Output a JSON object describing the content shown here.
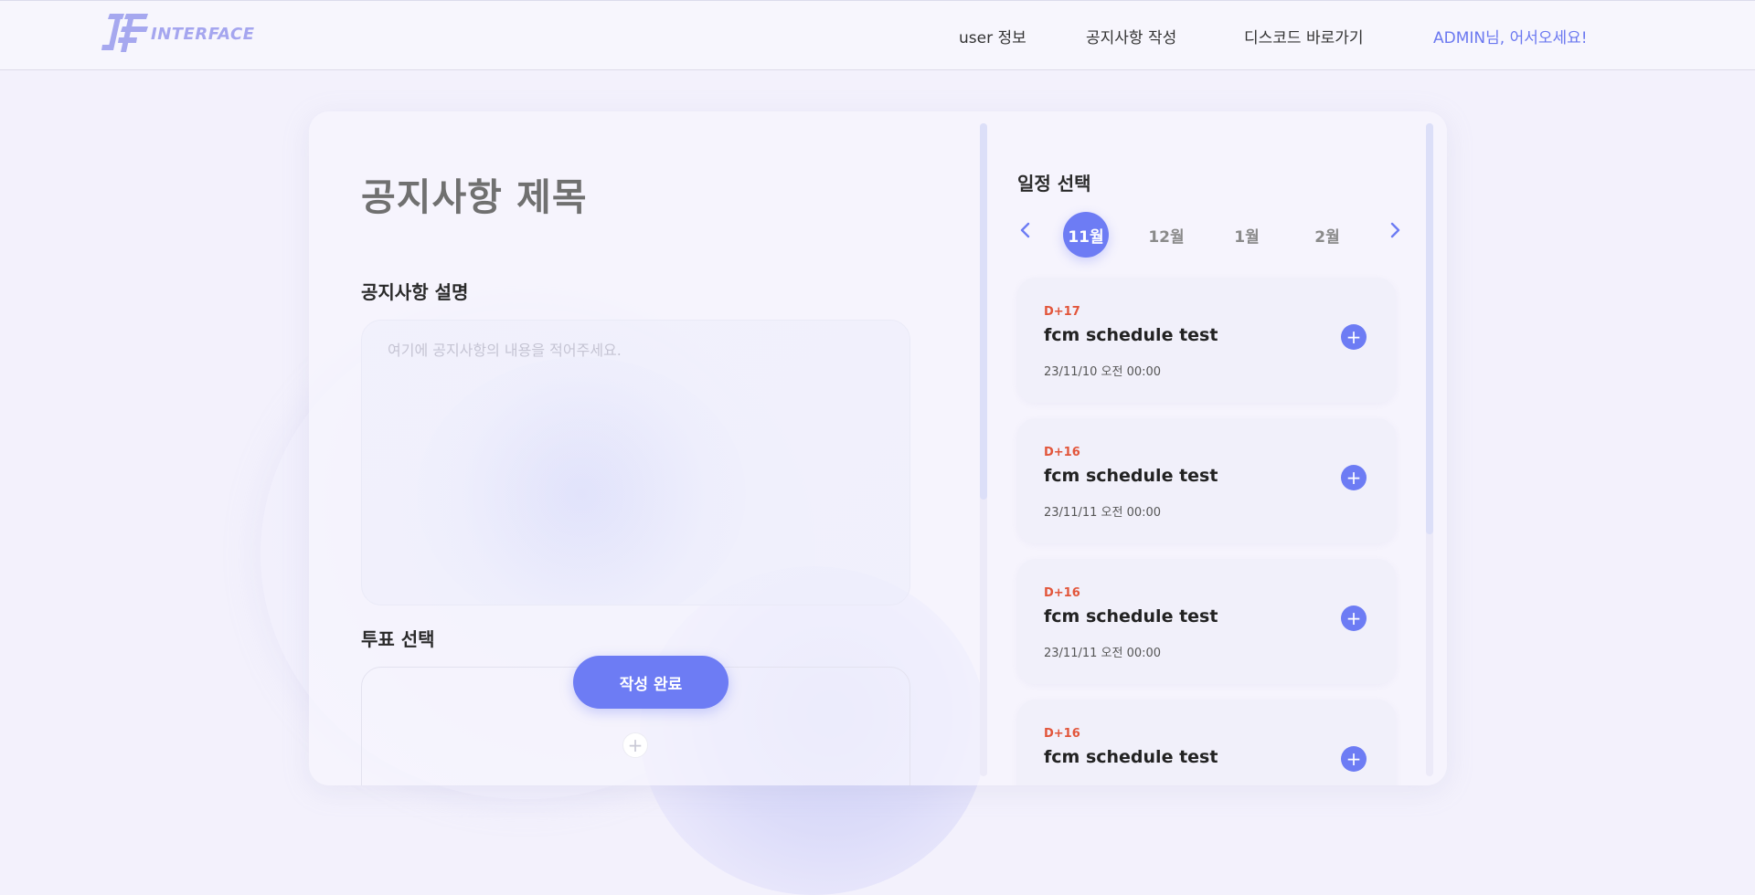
{
  "header": {
    "logo_text": "INTERFACE",
    "nav": {
      "user_info": "user 정보",
      "write_notice": "공지사항 작성",
      "discord": "디스코드 바로가기",
      "greeting": "ADMIN님, 어서오세요!"
    }
  },
  "form": {
    "title_placeholder": "공지사항 제목",
    "description_label": "공지사항 설명",
    "description_placeholder": "여기에 공지사항의 내용을 적어주세요.",
    "vote_label": "투표 선택",
    "submit_label": "작성 완료",
    "add_vote_symbol": "+"
  },
  "schedule": {
    "label": "일정 선택",
    "months": [
      "11월",
      "12월",
      "1월",
      "2월"
    ],
    "active_month": "11월",
    "items": [
      {
        "dday": "D+17",
        "title": "fcm schedule test",
        "date": "23/11/10 오전 00:00"
      },
      {
        "dday": "D+16",
        "title": "fcm schedule test",
        "date": "23/11/11 오전 00:00"
      },
      {
        "dday": "D+16",
        "title": "fcm schedule test",
        "date": "23/11/11 오전 00:00"
      },
      {
        "dday": "D+16",
        "title": "fcm schedule test",
        "date": ""
      }
    ],
    "add_symbol": "+"
  },
  "colors": {
    "accent": "#6d7cf4",
    "dday": "#e2553a",
    "background": "#f3f1fc"
  }
}
